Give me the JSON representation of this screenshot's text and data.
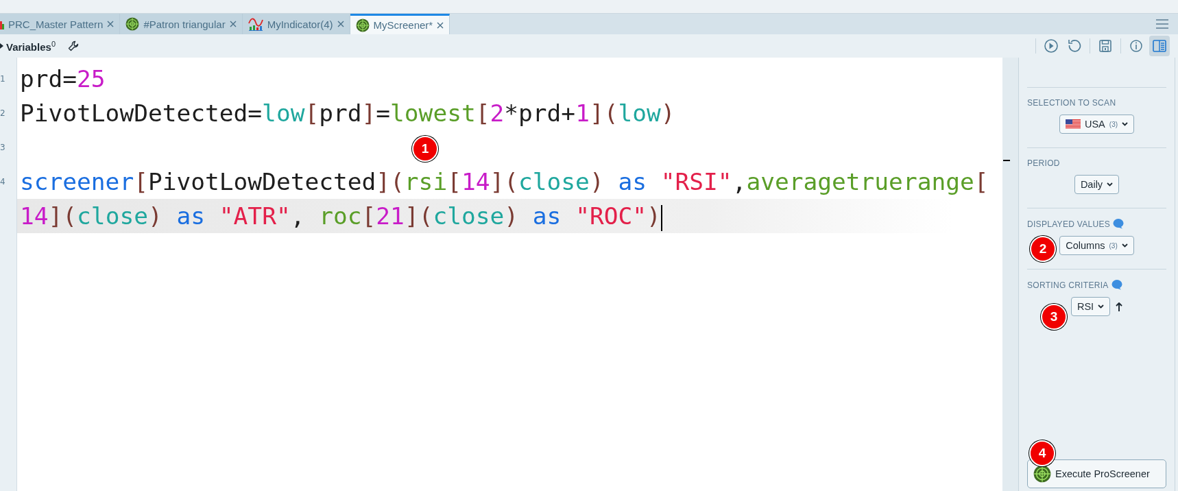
{
  "tabs": [
    {
      "label": "PRC_Master Pattern",
      "kind": "chart",
      "selected": false
    },
    {
      "label": "#Patron triangular",
      "kind": "radar",
      "selected": false
    },
    {
      "label": "MyIndicator(4)",
      "kind": "indicator",
      "selected": false
    },
    {
      "label": "MyScreener*",
      "kind": "radar",
      "selected": true
    }
  ],
  "toolbar": {
    "variables": {
      "label": "Variables",
      "count": "0"
    },
    "actions": [
      {
        "kind": "run",
        "selected": false
      },
      {
        "kind": "undo",
        "selected": false
      },
      {
        "kind": "save",
        "selected": false
      },
      {
        "kind": "info",
        "selected": false
      },
      {
        "kind": "panel",
        "selected": true
      }
    ]
  },
  "editor": {
    "lines": [
      {
        "number": "1",
        "rows": [
          {
            "current": false,
            "tokens": [
              {
                "t": "prd=",
                "kind": "plain"
              },
              {
                "t": "25",
                "kind": "number"
              }
            ]
          }
        ]
      },
      {
        "number": "2",
        "rows": [
          {
            "current": false,
            "tokens": [
              {
                "t": "PivotLowDetected=",
                "kind": "plain"
              },
              {
                "t": "low",
                "kind": "series"
              },
              {
                "t": "[",
                "kind": "bracket"
              },
              {
                "t": "prd",
                "kind": "plain"
              },
              {
                "t": "]",
                "kind": "bracket"
              },
              {
                "t": "=",
                "kind": "plain"
              },
              {
                "t": "lowest",
                "kind": "function"
              },
              {
                "t": "[",
                "kind": "bracket"
              },
              {
                "t": "2",
                "kind": "number"
              },
              {
                "t": "*prd+",
                "kind": "plain"
              },
              {
                "t": "1",
                "kind": "number"
              },
              {
                "t": "](",
                "kind": "bracket"
              },
              {
                "t": "low",
                "kind": "series"
              },
              {
                "t": ")",
                "kind": "bracket"
              }
            ]
          }
        ]
      },
      {
        "number": "3",
        "rows": [
          {
            "current": false,
            "tokens": []
          }
        ]
      },
      {
        "number": "4",
        "rows": [
          {
            "current": false,
            "tokens": [
              {
                "t": "screener",
                "kind": "keyword"
              },
              {
                "t": "[",
                "kind": "bracket"
              },
              {
                "t": "PivotLowDetected",
                "kind": "plain"
              },
              {
                "t": "](",
                "kind": "bracket"
              },
              {
                "t": "rsi",
                "kind": "function"
              },
              {
                "t": "[",
                "kind": "bracket"
              },
              {
                "t": "14",
                "kind": "number"
              },
              {
                "t": "](",
                "kind": "bracket"
              },
              {
                "t": "close",
                "kind": "series"
              },
              {
                "t": ")",
                "kind": "bracket"
              },
              {
                "t": " as ",
                "kind": "keyword"
              },
              {
                "t": "\"RSI\"",
                "kind": "string"
              },
              {
                "t": ",",
                "kind": "plain"
              },
              {
                "t": "averagetruerange",
                "kind": "function"
              },
              {
                "t": "[",
                "kind": "bracket"
              }
            ]
          },
          {
            "current": true,
            "tokens": [
              {
                "t": "14",
                "kind": "number"
              },
              {
                "t": "](",
                "kind": "bracket"
              },
              {
                "t": "close",
                "kind": "series"
              },
              {
                "t": ")",
                "kind": "bracket"
              },
              {
                "t": " as ",
                "kind": "keyword"
              },
              {
                "t": "\"ATR\"",
                "kind": "string"
              },
              {
                "t": ", ",
                "kind": "plain"
              },
              {
                "t": "roc",
                "kind": "function"
              },
              {
                "t": "[",
                "kind": "bracket"
              },
              {
                "t": "21",
                "kind": "number"
              },
              {
                "t": "](",
                "kind": "bracket"
              },
              {
                "t": "close",
                "kind": "series"
              },
              {
                "t": ")",
                "kind": "bracket"
              },
              {
                "t": " as ",
                "kind": "keyword"
              },
              {
                "t": "\"ROC\"",
                "kind": "string"
              },
              {
                "t": ")",
                "kind": "bracket"
              }
            ]
          }
        ]
      }
    ]
  },
  "panel": {
    "sections": [
      {
        "label": "SELECTION TO SCAN",
        "kind": "flag-select",
        "help": false,
        "value": "USA",
        "count": "(3)"
      },
      {
        "label": "PERIOD",
        "kind": "select",
        "help": false,
        "value": "Daily"
      },
      {
        "label": "DISPLAYED VALUES",
        "kind": "select",
        "help": true,
        "value": "Columns",
        "count": "(3)"
      },
      {
        "label": "SORTING CRITERIA",
        "kind": "sort",
        "help": true,
        "value": "RSI",
        "ascending": true
      }
    ],
    "execute_button": {
      "label": "Execute ProScreener"
    }
  },
  "annotations": [
    "1",
    "2",
    "3",
    "4"
  ]
}
